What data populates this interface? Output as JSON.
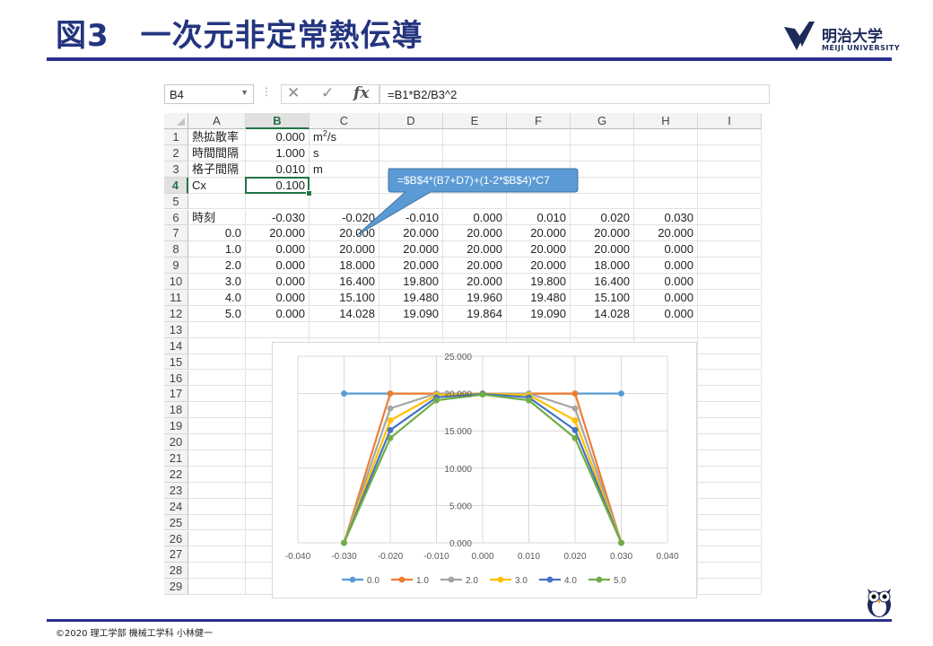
{
  "slide": {
    "title": "図3　一次元非定常熱伝導",
    "footer": "©2020  理工学部  機械工学科  小林健一",
    "logo_jp": "明治大学",
    "logo_en": "MEIJI UNIVERSITY"
  },
  "excel": {
    "name_box": "B4",
    "formula": "=B1*B2/B3^2",
    "icons": [
      "chevron-down-icon",
      "more-dots-icon",
      "cancel-x-icon",
      "enter-check-icon",
      "fx-icon"
    ],
    "columns": [
      "A",
      "B",
      "C",
      "D",
      "E",
      "F",
      "G",
      "H",
      "I"
    ],
    "selected_column": "B",
    "selected_row": 4,
    "rows": [
      {
        "n": "1",
        "cells": [
          "熱拡散率",
          "0.000",
          "m^2/s",
          "",
          "",
          "",
          "",
          "",
          ""
        ]
      },
      {
        "n": "2",
        "cells": [
          "時間間隔",
          "1.000",
          "s",
          "",
          "",
          "",
          "",
          "",
          ""
        ]
      },
      {
        "n": "3",
        "cells": [
          "格子間隔",
          "0.010",
          "m",
          "",
          "",
          "",
          "",
          "",
          ""
        ]
      },
      {
        "n": "4",
        "cells": [
          "Cx",
          "0.100",
          "",
          "",
          "",
          "",
          "",
          "",
          ""
        ]
      },
      {
        "n": "5",
        "cells": [
          "",
          "",
          "",
          "",
          "",
          "",
          "",
          "",
          ""
        ]
      },
      {
        "n": "6",
        "cells": [
          "時刻",
          "-0.030",
          "-0.020",
          "-0.010",
          "0.000",
          "0.010",
          "0.020",
          "0.030",
          ""
        ]
      },
      {
        "n": "7",
        "cells": [
          "0.0",
          "20.000",
          "20.000",
          "20.000",
          "20.000",
          "20.000",
          "20.000",
          "20.000",
          ""
        ]
      },
      {
        "n": "8",
        "cells": [
          "1.0",
          "0.000",
          "20.000",
          "20.000",
          "20.000",
          "20.000",
          "20.000",
          "0.000",
          ""
        ]
      },
      {
        "n": "9",
        "cells": [
          "2.0",
          "0.000",
          "18.000",
          "20.000",
          "20.000",
          "20.000",
          "18.000",
          "0.000",
          ""
        ]
      },
      {
        "n": "10",
        "cells": [
          "3.0",
          "0.000",
          "16.400",
          "19.800",
          "20.000",
          "19.800",
          "16.400",
          "0.000",
          ""
        ]
      },
      {
        "n": "11",
        "cells": [
          "4.0",
          "0.000",
          "15.100",
          "19.480",
          "19.960",
          "19.480",
          "15.100",
          "0.000",
          ""
        ]
      },
      {
        "n": "12",
        "cells": [
          "5.0",
          "0.000",
          "14.028",
          "19.090",
          "19.864",
          "19.090",
          "14.028",
          "0.000",
          ""
        ]
      },
      {
        "n": "13",
        "cells": []
      },
      {
        "n": "14",
        "cells": []
      },
      {
        "n": "15",
        "cells": []
      },
      {
        "n": "16",
        "cells": []
      },
      {
        "n": "17",
        "cells": []
      },
      {
        "n": "18",
        "cells": []
      },
      {
        "n": "19",
        "cells": []
      },
      {
        "n": "20",
        "cells": []
      },
      {
        "n": "21",
        "cells": []
      },
      {
        "n": "22",
        "cells": []
      },
      {
        "n": "23",
        "cells": []
      },
      {
        "n": "24",
        "cells": []
      },
      {
        "n": "25",
        "cells": []
      },
      {
        "n": "26",
        "cells": []
      },
      {
        "n": "27",
        "cells": []
      },
      {
        "n": "28",
        "cells": []
      },
      {
        "n": "29",
        "cells": []
      }
    ],
    "callout_text": "=$B$4*(B7+D7)+(1-2*$B$4)*C7",
    "callout_color": "#5b9bd5"
  },
  "chart_data": {
    "type": "line",
    "x": [
      -0.03,
      -0.02,
      -0.01,
      0.0,
      0.01,
      0.02,
      0.03
    ],
    "x_tick_labels": [
      "-0.040",
      "-0.030",
      "-0.020",
      "-0.010",
      "0.000",
      "0.010",
      "0.020",
      "0.030",
      "0.040"
    ],
    "y_tick_labels": [
      "0.000",
      "5.000",
      "10.000",
      "15.000",
      "20.000",
      "25.000"
    ],
    "xlim": [
      -0.04,
      0.04
    ],
    "ylim": [
      0,
      25
    ],
    "grid": true,
    "legend_position": "bottom",
    "series": [
      {
        "name": "0.0",
        "color": "#5b9bd5",
        "values": [
          20,
          20,
          20,
          20,
          20,
          20,
          20
        ]
      },
      {
        "name": "1.0",
        "color": "#ed7d31",
        "values": [
          0,
          20,
          20,
          20,
          20,
          20,
          0
        ]
      },
      {
        "name": "2.0",
        "color": "#a5a5a5",
        "values": [
          0,
          18,
          20,
          20,
          20,
          18,
          0
        ]
      },
      {
        "name": "3.0",
        "color": "#ffc000",
        "values": [
          0,
          16.4,
          19.8,
          20,
          19.8,
          16.4,
          0
        ]
      },
      {
        "name": "4.0",
        "color": "#4472c4",
        "values": [
          0,
          15.1,
          19.48,
          19.96,
          19.48,
          15.1,
          0
        ]
      },
      {
        "name": "5.0",
        "color": "#70ad47",
        "values": [
          0,
          14.028,
          19.09,
          19.864,
          19.09,
          14.028,
          0
        ]
      }
    ]
  }
}
